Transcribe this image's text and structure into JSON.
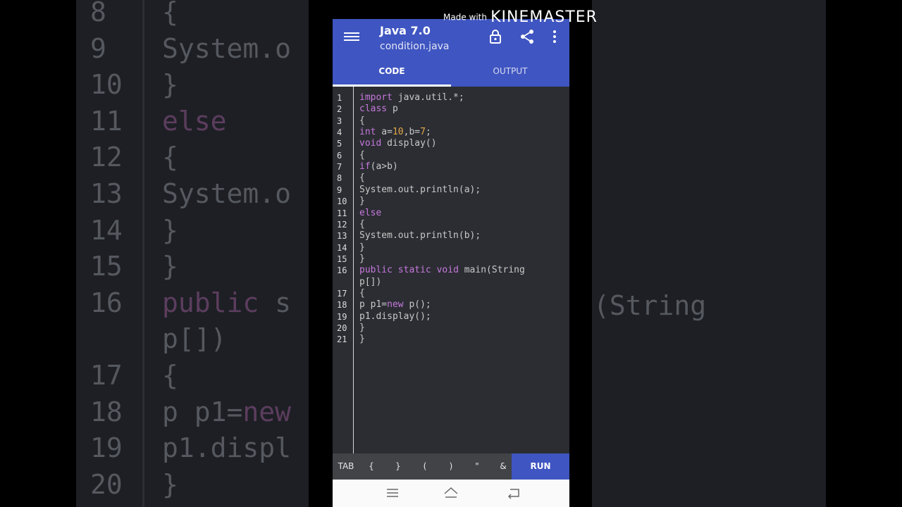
{
  "background": {
    "left_lines": [
      {
        "num": "8",
        "code": "{"
      },
      {
        "num": "9",
        "code": "System.o"
      },
      {
        "num": "10",
        "code": "}"
      },
      {
        "num": "11",
        "code": "else"
      },
      {
        "num": "12",
        "code": "{"
      },
      {
        "num": "13",
        "code": "System.o"
      },
      {
        "num": "14",
        "code": "}"
      },
      {
        "num": "15",
        "code": "}"
      },
      {
        "num": "16",
        "code": "public s"
      },
      {
        "num": "",
        "code": "p[])"
      },
      {
        "num": "17",
        "code": "{"
      },
      {
        "num": "18",
        "code": "p p1=new"
      },
      {
        "num": "19",
        "code": "p1.displ"
      },
      {
        "num": "20",
        "code": "}"
      }
    ],
    "right_text": "(String"
  },
  "watermark": {
    "made_with": "Made with",
    "brand": "KINEMASTER"
  },
  "app": {
    "title": "Java 7.0",
    "filename": "condition.java",
    "tabs": [
      "CODE",
      "OUTPUT"
    ],
    "active_tab": "CODE",
    "colors": {
      "primary": "#3f55c1",
      "editor_bg": "#2b2d32",
      "keyword": "#c678dd",
      "number": "#e5a84b"
    }
  },
  "code_lines": [
    {
      "num": "1",
      "text": "import java.util.*;"
    },
    {
      "num": "2",
      "text": "class p"
    },
    {
      "num": "3",
      "text": "{"
    },
    {
      "num": "4",
      "text": "int a=10,b=7;"
    },
    {
      "num": "5",
      "text": "void display()"
    },
    {
      "num": "6",
      "text": "{"
    },
    {
      "num": "7",
      "text": "if(a>b)"
    },
    {
      "num": "8",
      "text": "{"
    },
    {
      "num": "9",
      "text": "System.out.println(a);"
    },
    {
      "num": "10",
      "text": "}"
    },
    {
      "num": "11",
      "text": "else"
    },
    {
      "num": "12",
      "text": "{"
    },
    {
      "num": "13",
      "text": "System.out.println(b);"
    },
    {
      "num": "14",
      "text": "}"
    },
    {
      "num": "15",
      "text": "}"
    },
    {
      "num": "16",
      "text": "public static void main(String"
    },
    {
      "num": "",
      "text": "p[])"
    },
    {
      "num": "17",
      "text": "{"
    },
    {
      "num": "18",
      "text": "p p1=new p();"
    },
    {
      "num": "19",
      "text": "p1.display();"
    },
    {
      "num": "20",
      "text": "}"
    },
    {
      "num": "21",
      "text": "}"
    }
  ],
  "keybar": {
    "keys": [
      "TAB",
      "{",
      "}",
      "(",
      ")",
      "\"",
      "&"
    ],
    "run": "RUN"
  },
  "icons": {
    "menu": "menu-icon",
    "lock": "lock-icon",
    "share": "share-icon",
    "more": "more-vert-icon",
    "nav_recent": "recent-apps-icon",
    "nav_home": "home-icon",
    "nav_back": "back-icon"
  }
}
